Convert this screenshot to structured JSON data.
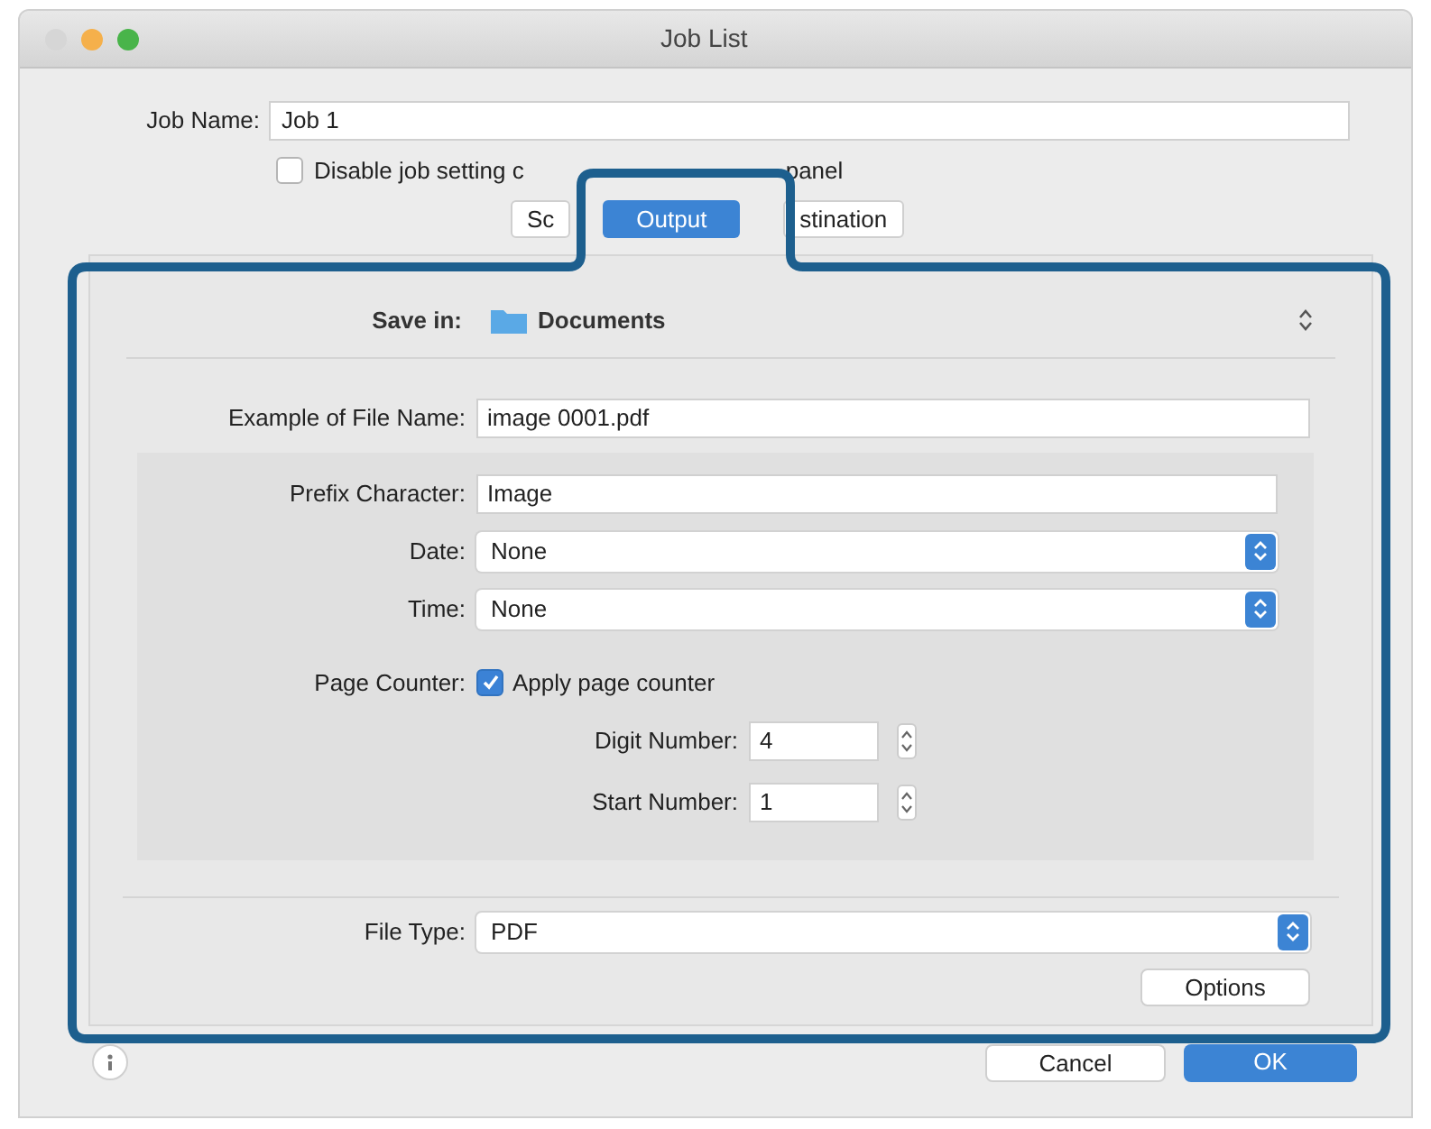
{
  "window": {
    "title": "Job List"
  },
  "job_name": {
    "label": "Job Name:",
    "value": "Job 1"
  },
  "disable_option": {
    "label_start": "Disable job setting c",
    "label_end": "panel",
    "checked": false
  },
  "tabs": [
    {
      "label": "Sc",
      "selected": false
    },
    {
      "label": "Output",
      "selected": true
    },
    {
      "label": "stination",
      "selected": false
    }
  ],
  "save_in": {
    "label": "Save in:",
    "value": "Documents"
  },
  "example": {
    "label": "Example of File Name:",
    "value": "image 0001.pdf"
  },
  "fields": [
    {
      "kind": "text",
      "label": "Prefix Character:",
      "value": "Image"
    },
    {
      "kind": "select",
      "label": "Date:",
      "value": "None"
    },
    {
      "kind": "select",
      "label": "Time:",
      "value": "None"
    }
  ],
  "page_counter": {
    "label": "Page Counter:",
    "option": "Apply page counter",
    "checked": true,
    "steppers": [
      {
        "label": "Digit Number:",
        "value": "4"
      },
      {
        "label": "Start Number:",
        "value": "1"
      }
    ]
  },
  "file_type": {
    "label": "File Type:",
    "value": "PDF"
  },
  "buttons": {
    "options": "Options",
    "cancel": "Cancel",
    "ok": "OK"
  }
}
